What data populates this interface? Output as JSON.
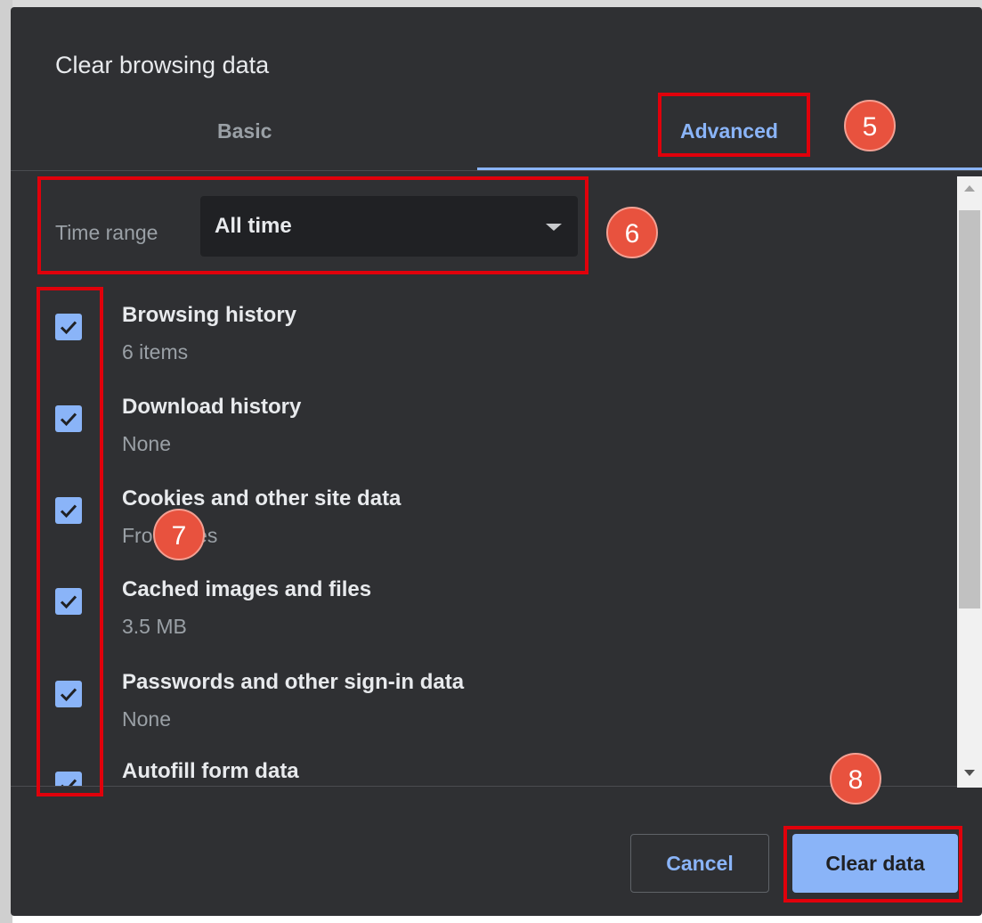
{
  "dialog": {
    "title": "Clear browsing data",
    "tabs": [
      {
        "label": "Basic",
        "selected": false
      },
      {
        "label": "Advanced",
        "selected": true
      }
    ],
    "time_range": {
      "label": "Time range",
      "value": "All time"
    },
    "items": [
      {
        "title": "Browsing history",
        "subtitle": "6 items",
        "checked": true
      },
      {
        "title": "Download history",
        "subtitle": "None",
        "checked": true
      },
      {
        "title": "Cookies and other site data",
        "subtitle": "From sites",
        "checked": true
      },
      {
        "title": "Cached images and files",
        "subtitle": "3.5 MB",
        "checked": true
      },
      {
        "title": "Passwords and other sign-in data",
        "subtitle": "None",
        "checked": true
      },
      {
        "title": "Autofill form data",
        "subtitle": "",
        "checked": true
      }
    ],
    "buttons": {
      "cancel": "Cancel",
      "clear": "Clear data"
    }
  },
  "annotations": {
    "step_5": "5",
    "step_6": "6",
    "step_7": "7",
    "step_8": "8",
    "color": "#e0000b",
    "badge_color": "#e8523e"
  },
  "colors": {
    "dialog_bg": "#2f3033",
    "accent": "#8ab4f8",
    "text": "#e8eaed",
    "muted": "#9aa0a6"
  }
}
